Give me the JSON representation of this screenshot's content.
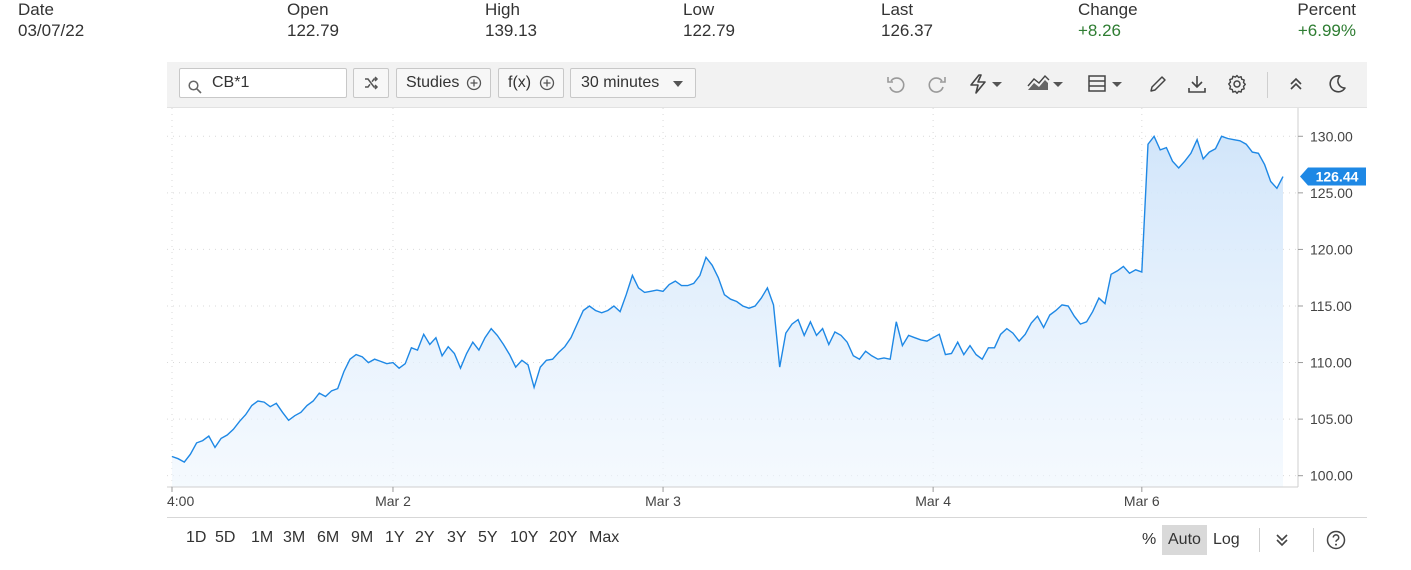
{
  "quote": {
    "date_label": "Date",
    "date": "03/07/22",
    "open_label": "Open",
    "open": "122.79",
    "high_label": "High",
    "high": "139.13",
    "low_label": "Low",
    "low": "122.79",
    "last_label": "Last",
    "last": "126.37",
    "change_label": "Change",
    "change": "+8.26",
    "percent_label": "Percent",
    "percent": "+6.99%",
    "positive_color": "#2e7d32"
  },
  "toolbar": {
    "symbol_value": "CB*1",
    "studies_label": "Studies",
    "fx_label": "f(x)",
    "interval_label": "30 minutes",
    "icons": [
      "search-icon",
      "shuffle-icon",
      "plus-circle-icon",
      "undo-icon",
      "redo-icon",
      "lightning-icon",
      "chart-type-icon",
      "layout-icon",
      "pencil-icon",
      "download-icon",
      "gear-icon",
      "collapse-icon",
      "dark-mode-icon"
    ]
  },
  "ranges": [
    "1D",
    "5D",
    "1M",
    "3M",
    "6M",
    "9M",
    "1Y",
    "2Y",
    "3Y",
    "5Y",
    "10Y",
    "20Y",
    "Max"
  ],
  "scale": {
    "percent": "%",
    "auto": "Auto",
    "log": "Log"
  },
  "chart_data": {
    "type": "area",
    "line_color": "#1e88e5",
    "fill_color": "#d6e9fb",
    "ylim": [
      99,
      132.5
    ],
    "yticks": [
      {
        "label": "130.00",
        "value": 130
      },
      {
        "label": "125.00",
        "value": 125
      },
      {
        "label": "120.00",
        "value": 120
      },
      {
        "label": "115.00",
        "value": 115
      },
      {
        "label": "110.00",
        "value": 110
      },
      {
        "label": "105.00",
        "value": 105
      },
      {
        "label": "100.00",
        "value": 100
      }
    ],
    "xticks": [
      {
        "label": "4:00",
        "index": 0
      },
      {
        "label": "Mar 2",
        "index": 36
      },
      {
        "label": "Mar 3",
        "index": 80
      },
      {
        "label": "Mar 4",
        "index": 124
      },
      {
        "label": "Mar 6",
        "index": 158
      }
    ],
    "x_count": 179,
    "last_price_label": "126.44",
    "last_price": 126.44,
    "values": [
      [
        0,
        101.7
      ],
      [
        1,
        101.5
      ],
      [
        2,
        101.2
      ],
      [
        3,
        101.9
      ],
      [
        4,
        102.9
      ],
      [
        5,
        103.1
      ],
      [
        6,
        103.5
      ],
      [
        7,
        102.5
      ],
      [
        8,
        103.3
      ],
      [
        9,
        103.6
      ],
      [
        10,
        104.1
      ],
      [
        11,
        104.8
      ],
      [
        12,
        105.4
      ],
      [
        13,
        106.2
      ],
      [
        14,
        106.6
      ],
      [
        15,
        106.5
      ],
      [
        16,
        106.1
      ],
      [
        17,
        106.4
      ],
      [
        18,
        105.6
      ],
      [
        19,
        104.9
      ],
      [
        20,
        105.3
      ],
      [
        21,
        105.6
      ],
      [
        22,
        106.2
      ],
      [
        23,
        106.6
      ],
      [
        24,
        107.3
      ],
      [
        25,
        107.0
      ],
      [
        26,
        107.5
      ],
      [
        27,
        107.7
      ],
      [
        28,
        109.2
      ],
      [
        29,
        110.3
      ],
      [
        30,
        110.7
      ],
      [
        31,
        110.5
      ],
      [
        32,
        110.0
      ],
      [
        33,
        110.3
      ],
      [
        34,
        110.1
      ],
      [
        35,
        109.9
      ],
      [
        36,
        110.0
      ],
      [
        37,
        109.5
      ],
      [
        38,
        109.9
      ],
      [
        39,
        111.3
      ],
      [
        40,
        111.1
      ],
      [
        41,
        112.5
      ],
      [
        42,
        111.6
      ],
      [
        43,
        112.2
      ],
      [
        44,
        110.6
      ],
      [
        45,
        111.4
      ],
      [
        46,
        110.8
      ],
      [
        47,
        109.5
      ],
      [
        48,
        110.8
      ],
      [
        49,
        111.8
      ],
      [
        50,
        111.1
      ],
      [
        51,
        112.2
      ],
      [
        52,
        113.0
      ],
      [
        53,
        112.4
      ],
      [
        54,
        111.6
      ],
      [
        55,
        110.7
      ],
      [
        56,
        109.6
      ],
      [
        57,
        110.2
      ],
      [
        58,
        109.8
      ],
      [
        59,
        107.8
      ],
      [
        60,
        109.6
      ],
      [
        61,
        110.2
      ],
      [
        62,
        110.3
      ],
      [
        63,
        110.9
      ],
      [
        64,
        111.4
      ],
      [
        65,
        112.2
      ],
      [
        66,
        113.4
      ],
      [
        67,
        114.6
      ],
      [
        68,
        115.0
      ],
      [
        69,
        114.6
      ],
      [
        70,
        114.4
      ],
      [
        71,
        114.6
      ],
      [
        72,
        115.0
      ],
      [
        73,
        114.5
      ],
      [
        74,
        116.0
      ],
      [
        75,
        117.7
      ],
      [
        76,
        116.6
      ],
      [
        77,
        116.2
      ],
      [
        78,
        116.3
      ],
      [
        79,
        116.4
      ],
      [
        80,
        116.3
      ],
      [
        81,
        116.9
      ],
      [
        82,
        117.2
      ],
      [
        83,
        116.8
      ],
      [
        84,
        116.8
      ],
      [
        85,
        117.0
      ],
      [
        86,
        117.7
      ],
      [
        87,
        119.3
      ],
      [
        88,
        118.6
      ],
      [
        89,
        117.5
      ],
      [
        90,
        116.0
      ],
      [
        91,
        115.6
      ],
      [
        92,
        115.4
      ],
      [
        93,
        115.0
      ],
      [
        94,
        114.8
      ],
      [
        95,
        115.0
      ],
      [
        96,
        115.7
      ],
      [
        97,
        116.6
      ],
      [
        98,
        115.1
      ],
      [
        99,
        109.6
      ],
      [
        100,
        112.6
      ],
      [
        101,
        113.4
      ],
      [
        102,
        113.8
      ],
      [
        103,
        112.4
      ],
      [
        104,
        113.6
      ],
      [
        105,
        112.4
      ],
      [
        106,
        113.0
      ],
      [
        107,
        111.6
      ],
      [
        108,
        112.7
      ],
      [
        109,
        112.4
      ],
      [
        110,
        111.8
      ],
      [
        111,
        110.6
      ],
      [
        112,
        110.3
      ],
      [
        113,
        111.0
      ],
      [
        114,
        110.6
      ],
      [
        115,
        110.3
      ],
      [
        116,
        110.4
      ],
      [
        117,
        110.3
      ],
      [
        118,
        113.6
      ],
      [
        119,
        111.5
      ],
      [
        120,
        112.4
      ],
      [
        121,
        112.2
      ],
      [
        122,
        112.0
      ],
      [
        123,
        111.9
      ],
      [
        124,
        112.2
      ],
      [
        125,
        112.5
      ],
      [
        126,
        110.7
      ],
      [
        127,
        110.8
      ],
      [
        128,
        111.8
      ],
      [
        129,
        110.7
      ],
      [
        130,
        111.5
      ],
      [
        131,
        110.7
      ],
      [
        132,
        110.3
      ],
      [
        133,
        111.3
      ],
      [
        134,
        111.3
      ],
      [
        135,
        112.5
      ],
      [
        136,
        113.0
      ],
      [
        137,
        112.6
      ],
      [
        138,
        111.9
      ],
      [
        139,
        112.5
      ],
      [
        140,
        113.5
      ],
      [
        141,
        114.1
      ],
      [
        142,
        113.1
      ],
      [
        143,
        114.2
      ],
      [
        144,
        114.6
      ],
      [
        145,
        115.1
      ],
      [
        146,
        115.0
      ],
      [
        147,
        114.1
      ],
      [
        148,
        113.4
      ],
      [
        149,
        113.6
      ],
      [
        150,
        114.5
      ],
      [
        151,
        115.7
      ],
      [
        152,
        115.2
      ],
      [
        153,
        117.8
      ],
      [
        154,
        118.1
      ],
      [
        155,
        118.5
      ],
      [
        156,
        117.9
      ],
      [
        157,
        118.2
      ],
      [
        158,
        118.0
      ],
      [
        159,
        129.3
      ],
      [
        160,
        130.0
      ],
      [
        161,
        128.8
      ],
      [
        162,
        129.0
      ],
      [
        163,
        127.8
      ],
      [
        164,
        127.2
      ],
      [
        165,
        127.8
      ],
      [
        166,
        128.5
      ],
      [
        167,
        129.7
      ],
      [
        168,
        128.0
      ],
      [
        169,
        128.6
      ],
      [
        170,
        128.9
      ],
      [
        171,
        130.0
      ],
      [
        172,
        129.8
      ],
      [
        173,
        129.7
      ],
      [
        174,
        129.6
      ],
      [
        175,
        129.3
      ],
      [
        176,
        128.6
      ],
      [
        177,
        128.5
      ],
      [
        178,
        127.5
      ],
      [
        179,
        126.0
      ],
      [
        180,
        125.4
      ],
      [
        181,
        126.44
      ]
    ]
  }
}
